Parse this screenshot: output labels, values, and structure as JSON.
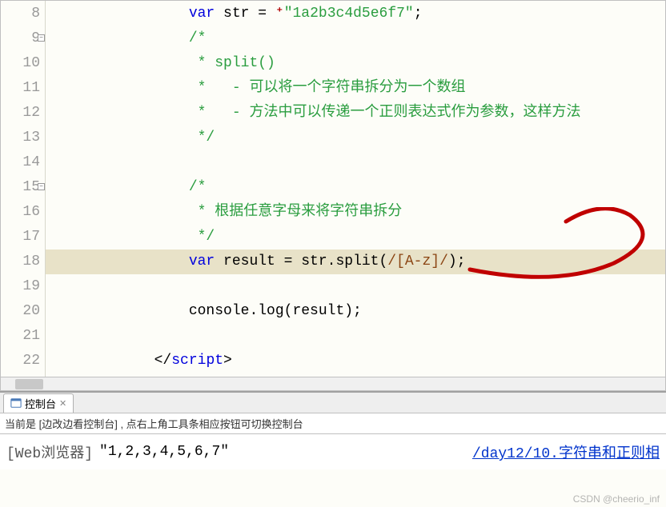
{
  "gutter": {
    "lines": [
      "8",
      "9",
      "10",
      "11",
      "12",
      "13",
      "14",
      "15",
      "16",
      "17",
      "18",
      "19",
      "20",
      "21",
      "22"
    ],
    "fold_lines": [
      9,
      15
    ]
  },
  "code": {
    "indent4": "                ",
    "indent5": "                    ",
    "l8_kw": "var",
    "l8_mid": " str = ",
    "l8_str": "\"1a2b3c4d5e6f7\"",
    "l8_end": ";",
    "l9": "/*",
    "l10": " * split()",
    "l11": " *   - 可以将一个字符串拆分为一个数组",
    "l12": " *   - 方法中可以传递一个正则表达式作为参数，这样方法",
    "l13": " */",
    "l15": "/*",
    "l16": " * 根据任意字母来将字符串拆分",
    "l17": " */",
    "l18_kw": "var",
    "l18_mid": " result = str.split(",
    "l18_regex": "/[A-z]/",
    "l18_end": ");",
    "l20": "console.log(result);",
    "l22_open": "</",
    "l22_tag": "script",
    "l22_close": ">"
  },
  "tab": {
    "label": "控制台",
    "close": "✕"
  },
  "status": "当前是 [边改边看控制台] , 点右上角工具条相应按钮可切换控制台",
  "console": {
    "prefix": "[Web浏览器]",
    "value": "\"1,2,3,4,5,6,7\"",
    "link": "/day12/10.字符串和正则相"
  },
  "watermark": "CSDN @cheerio_inf"
}
